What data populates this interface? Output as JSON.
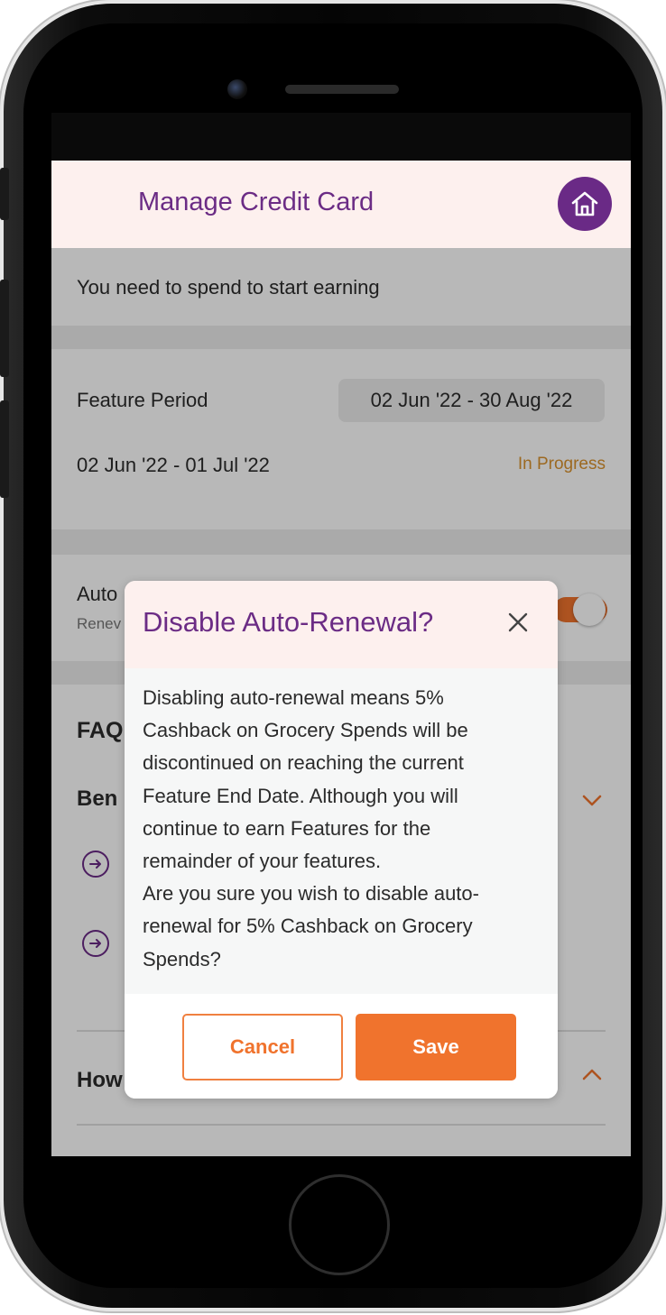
{
  "colors": {
    "brand_purple": "#6b2c85",
    "accent_orange": "#f0732d",
    "status_amber": "#d9922e",
    "header_bg": "#fdf0ee"
  },
  "header": {
    "title": "Manage Credit Card",
    "home_icon": "home-icon"
  },
  "spend_notice": "You need to spend to start earning",
  "feature_period": {
    "label": "Feature Period",
    "range": "02 Jun '22 - 30 Aug '22",
    "cycle": "02 Jun '22 - 01 Jul '22",
    "status": "In Progress"
  },
  "auto_renewal": {
    "label_visible": "Auto",
    "sublabel_visible": "Renev",
    "enabled": true
  },
  "faq": {
    "title_visible": "FAQ",
    "item1_label_visible": "Ben",
    "item2_label_visible": "How",
    "item1_expanded": true,
    "item2_expanded": false
  },
  "modal": {
    "title": "Disable Auto-Renewal?",
    "close_icon": "close-icon",
    "body_line1": "Disabling auto-renewal means 5%",
    "body_line2": "Cashback on Grocery Spends will be",
    "body_line3": "discontinued on reaching the current",
    "body_line4": "Feature End Date. Although you will",
    "body_line5": "continue to earn Features for the",
    "body_line6": "remainder of your features.",
    "body_line7": "Are you sure you wish to disable auto-",
    "body_line8": "renewal for 5% Cashback on Grocery",
    "body_line9": "Spends?",
    "cancel_label": "Cancel",
    "save_label": "Save"
  }
}
